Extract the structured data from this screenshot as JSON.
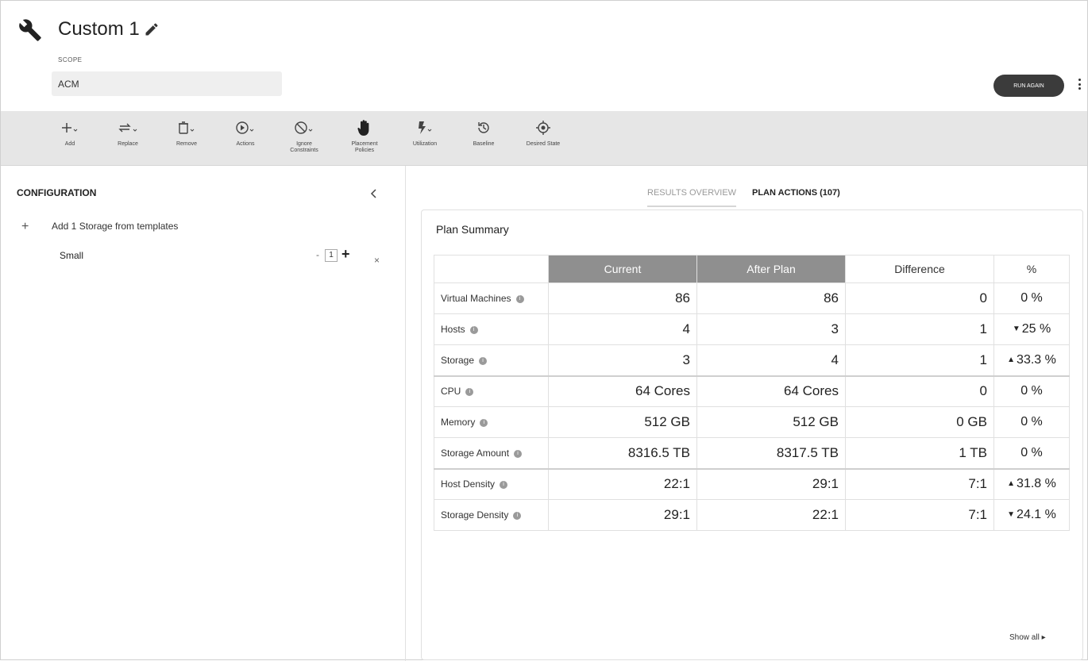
{
  "header": {
    "title": "Custom 1",
    "scope_label": "SCOPE",
    "scope_value": "ACM",
    "run_again_label": "RUN AGAIN"
  },
  "toolbar": {
    "items": [
      {
        "label": "Add",
        "icon": "plus-icon"
      },
      {
        "label": "Replace",
        "icon": "replace-icon"
      },
      {
        "label": "Remove",
        "icon": "trash-icon"
      },
      {
        "label": "Actions",
        "icon": "play-circle-icon"
      },
      {
        "label": "Ignore Constraints",
        "icon": "block-icon"
      },
      {
        "label": "Placement Policies",
        "icon": "hand-icon"
      },
      {
        "label": "Utilization",
        "icon": "bolt-icon"
      },
      {
        "label": "Baseline",
        "icon": "history-icon"
      },
      {
        "label": "Desired State",
        "icon": "target-icon"
      }
    ]
  },
  "configuration": {
    "title": "CONFIGURATION",
    "add_text": "Add 1 Storage from templates",
    "template_name": "Small",
    "quantity": "1",
    "minus": "-",
    "remove": "×"
  },
  "tabs": {
    "results_overview": "RESULTS OVERVIEW",
    "plan_actions": "PLAN ACTIONS (107)"
  },
  "plan_summary": {
    "title": "Plan Summary",
    "columns": [
      "Current",
      "After Plan",
      "Difference",
      "%"
    ],
    "rows": [
      {
        "metric": "Virtual Machines",
        "current": "86",
        "after": "86",
        "diff": "0",
        "pct": "0 %",
        "trend": ""
      },
      {
        "metric": "Hosts",
        "current": "4",
        "after": "3",
        "diff": "1",
        "pct": "25 %",
        "trend": "down"
      },
      {
        "metric": "Storage",
        "current": "3",
        "after": "4",
        "diff": "1",
        "pct": "33.3 %",
        "trend": "up"
      },
      {
        "metric": "CPU",
        "current": "64 Cores",
        "after": "64 Cores",
        "diff": "0",
        "pct": "0 %",
        "trend": ""
      },
      {
        "metric": "Memory",
        "current": "512 GB",
        "after": "512 GB",
        "diff": "0 GB",
        "pct": "0 %",
        "trend": ""
      },
      {
        "metric": "Storage Amount",
        "current": "8316.5 TB",
        "after": "8317.5 TB",
        "diff": "1 TB",
        "pct": "0 %",
        "trend": ""
      },
      {
        "metric": "Host Density",
        "current": "22:1",
        "after": "29:1",
        "diff": "7:1",
        "pct": "31.8 %",
        "trend": "up"
      },
      {
        "metric": "Storage Density",
        "current": "29:1",
        "after": "22:1",
        "diff": "7:1",
        "pct": "24.1 %",
        "trend": "down"
      }
    ],
    "show_all": "Show all ▸"
  }
}
